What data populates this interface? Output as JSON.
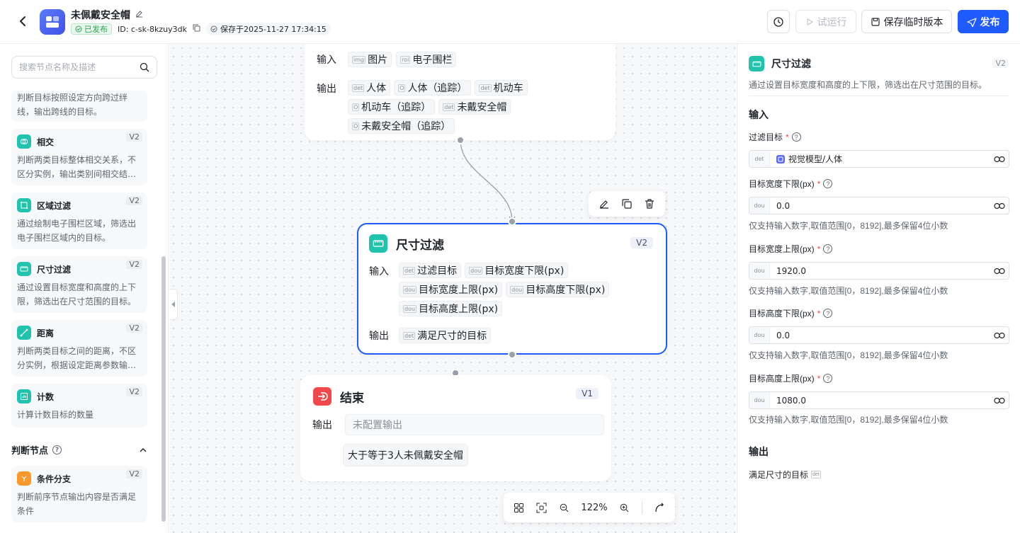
{
  "header": {
    "title": "未佩戴安全帽",
    "status": "已发布",
    "id_text": "ID: c-sk-8kzuy3dk",
    "saved_text": "保存于2025-11-27 17:34:15",
    "test_run": "试运行",
    "save_temp": "保存临时版本",
    "publish": "发布"
  },
  "sidebar": {
    "search_placeholder": "搜索节点名称及描述",
    "items": [
      {
        "desc": "判断目标按照设定方向跨过绊线，输出跨线的目标。"
      },
      {
        "title": "相交",
        "version": "V2",
        "desc": "判断两类目标整体相交关系，不区分实例，输出类别间相交结…"
      },
      {
        "title": "区域过滤",
        "version": "V2",
        "desc": "通过绘制电子围栏区域，筛选出电子围栏区域内的目标。"
      },
      {
        "title": "尺寸过滤",
        "version": "V2",
        "desc": "通过设置目标宽度和高度的上下限，筛选出在尺寸范围的目标。"
      },
      {
        "title": "距离",
        "version": "V2",
        "desc": "判断两类目标之间的距离，不区分实例，根据设定距离参数输…"
      },
      {
        "title": "计数",
        "version": "V2",
        "desc": "计算计数目标的数量"
      }
    ],
    "section_title": "判断节点",
    "section_items": [
      {
        "title": "条件分支",
        "version": "V2",
        "desc": "判断前序节点输出内容是否满足条件"
      }
    ]
  },
  "canvas": {
    "top_node": {
      "input_label": "输入",
      "output_label": "输出",
      "inputs": [
        {
          "tag": "img",
          "text": "图片"
        },
        {
          "tag": "roi",
          "text": "电子围栏"
        }
      ],
      "outputs": [
        {
          "tag": "det",
          "text": "人体"
        },
        {
          "tag": "O",
          "text": "人体（追踪）"
        },
        {
          "tag": "det",
          "text": "机动车"
        },
        {
          "tag": "O",
          "text": "机动车（追踪）"
        },
        {
          "tag": "det",
          "text": "未戴安全帽"
        },
        {
          "tag": "O",
          "text": "未戴安全帽（追踪）"
        }
      ]
    },
    "size_node": {
      "title": "尺寸过滤",
      "version": "V2",
      "input_label": "输入",
      "output_label": "输出",
      "inputs": [
        {
          "tag": "det",
          "text": "过滤目标"
        },
        {
          "tag": "dou",
          "text": "目标宽度下限(px)"
        },
        {
          "tag": "dou",
          "text": "目标宽度上限(px)"
        },
        {
          "tag": "dou",
          "text": "目标高度下限(px)"
        },
        {
          "tag": "dou",
          "text": "目标高度上限(px)"
        }
      ],
      "outputs": [
        {
          "tag": "det",
          "text": "满足尺寸的目标"
        }
      ]
    },
    "end_node": {
      "title": "结束",
      "version": "V1",
      "output_label": "输出",
      "output_placeholder": "未配置输出",
      "output_text": "大于等于3人未佩戴安全帽"
    },
    "zoom": "122%"
  },
  "panel": {
    "title": "尺寸过滤",
    "version": "V2",
    "desc": "通过设置目标宽度和高度的上下限，筛选出在尺寸范围的目标。",
    "input_section": "输入",
    "filter_label": "过滤目标",
    "filter_value": "视觉模型/人体",
    "fields": [
      {
        "label": "目标宽度下限(px)",
        "value": "0.0",
        "hint": "仅支持输入数字,取值范围[0，8192],最多保留4位小数"
      },
      {
        "label": "目标宽度上限(px)",
        "value": "1920.0",
        "hint": "仅支持输入数字,取值范围[0，8192],最多保留4位小数"
      },
      {
        "label": "目标高度下限(px)",
        "value": "0.0",
        "hint": "仅支持输入数字,取值范围[0，8192],最多保留4位小数"
      },
      {
        "label": "目标高度上限(px)",
        "value": "1080.0",
        "hint": "仅支持输入数字,取值范围[0，8192],最多保留4位小数"
      }
    ],
    "output_section": "输出",
    "output_text": "满足尺寸的目标"
  }
}
